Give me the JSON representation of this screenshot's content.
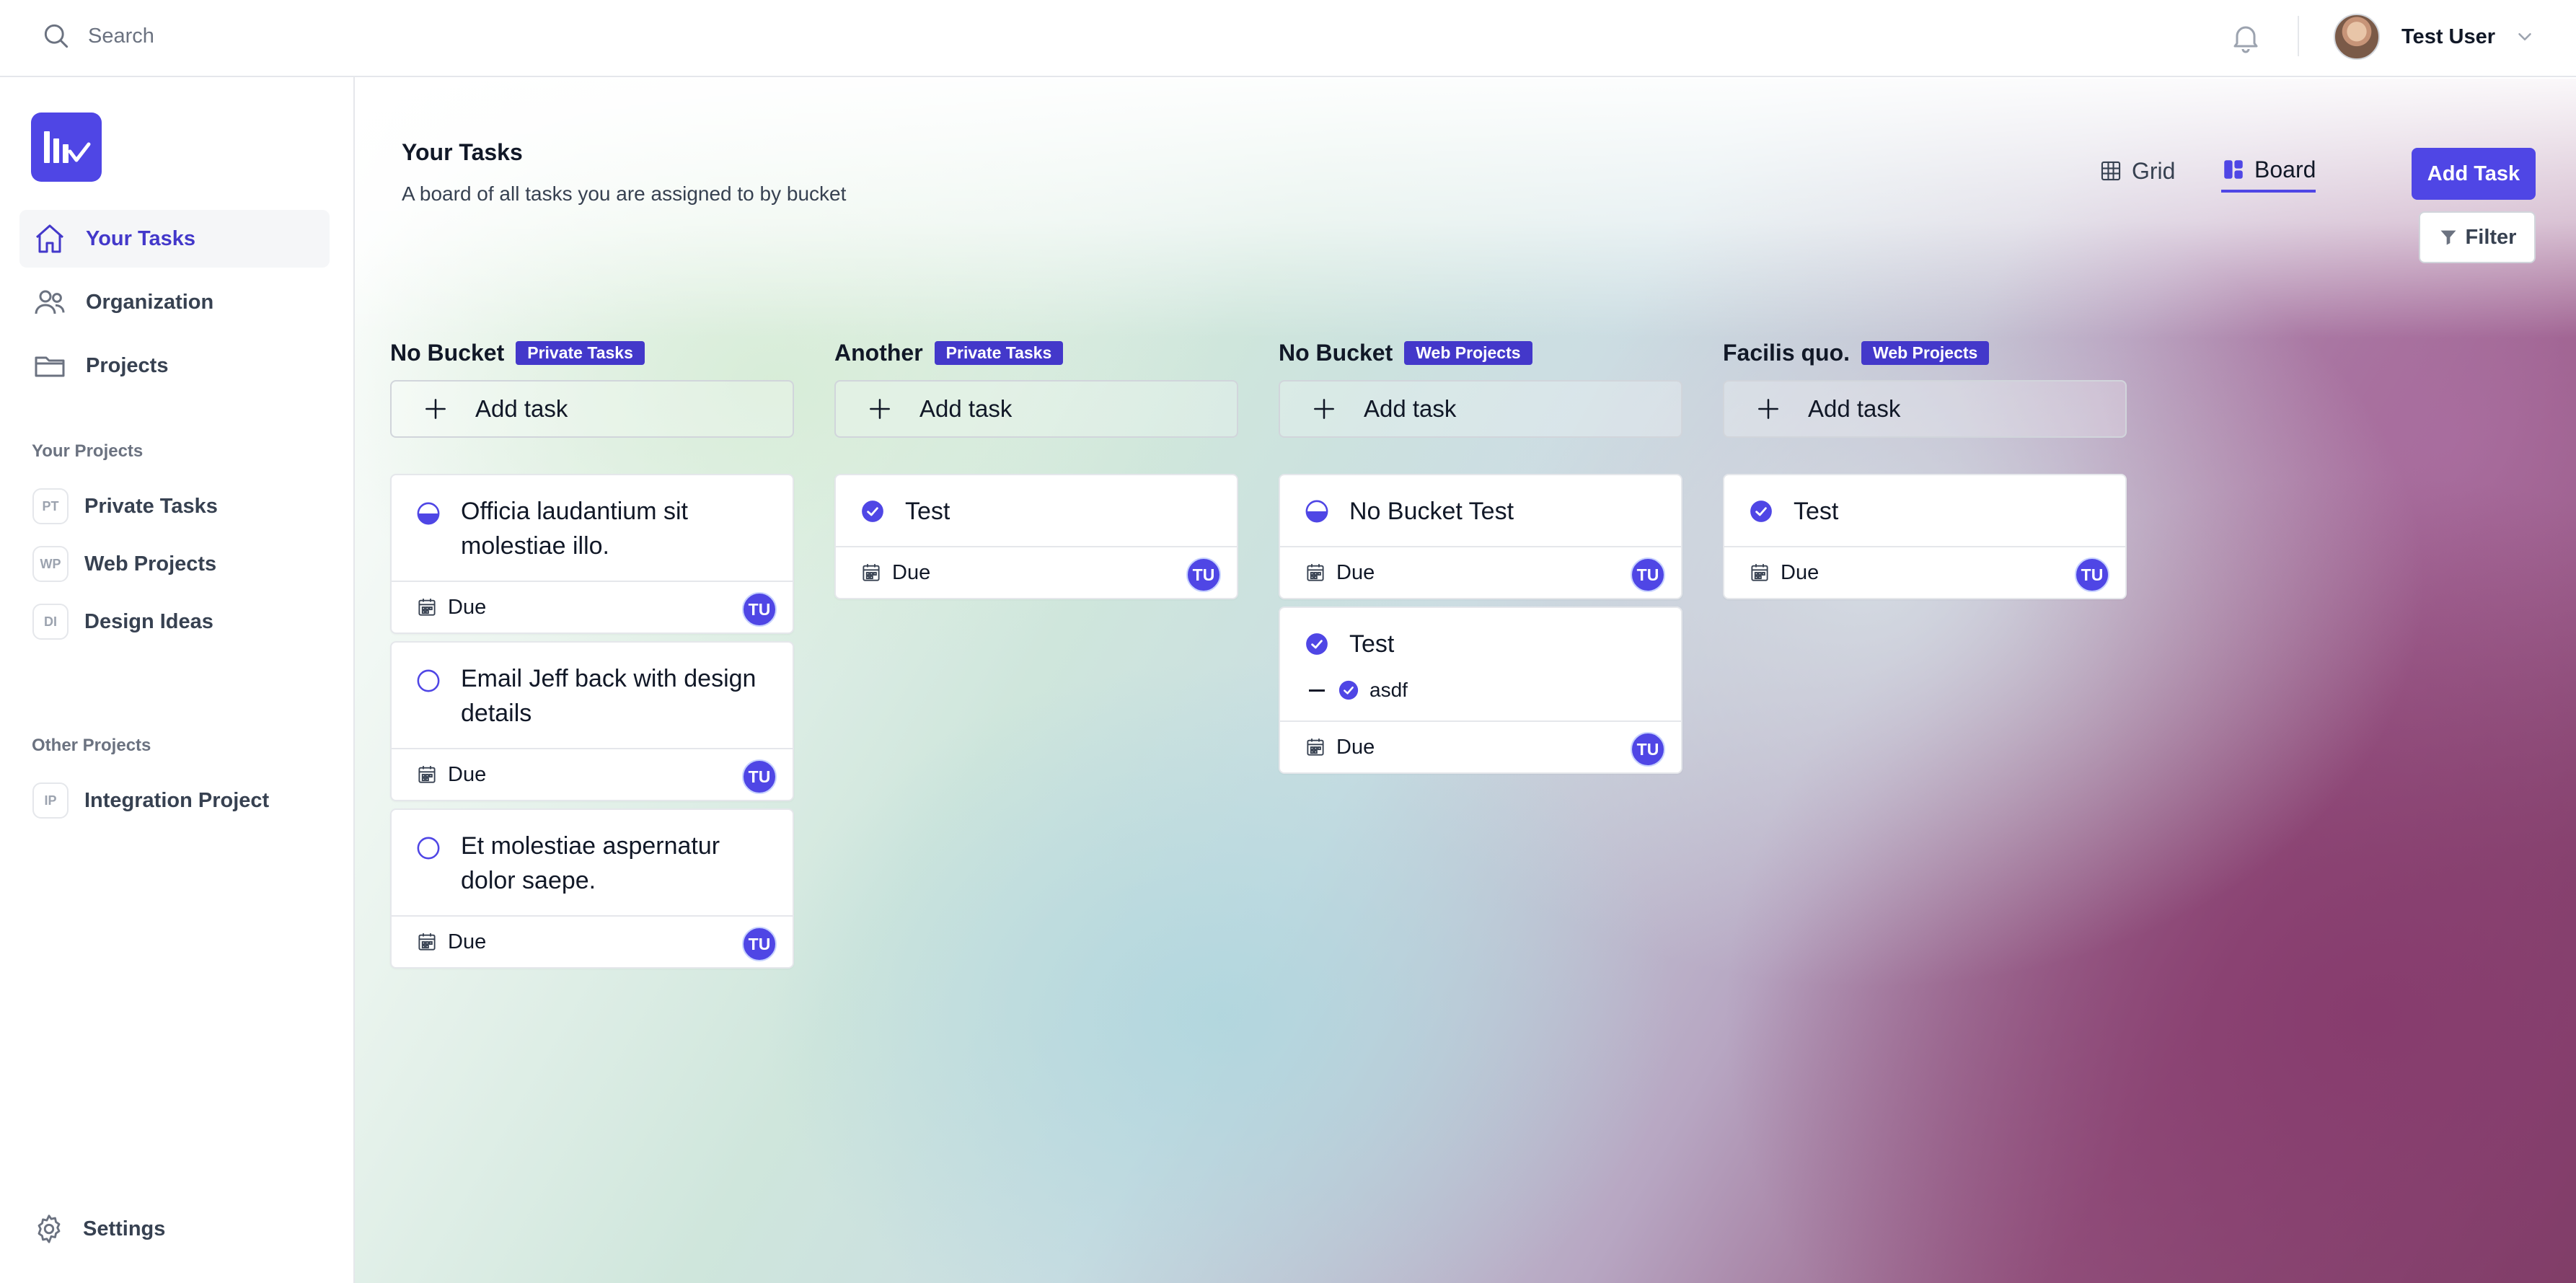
{
  "header": {
    "search_placeholder": "Search",
    "user_name": "Test User"
  },
  "sidebar": {
    "nav": [
      {
        "label": "Your Tasks",
        "icon": "home-icon"
      },
      {
        "label": "Organization",
        "icon": "users-icon"
      },
      {
        "label": "Projects",
        "icon": "folder-icon"
      }
    ],
    "your_projects_title": "Your Projects",
    "your_projects": [
      {
        "badge": "PT",
        "label": "Private Tasks"
      },
      {
        "badge": "WP",
        "label": "Web Projects"
      },
      {
        "badge": "DI",
        "label": "Design Ideas"
      }
    ],
    "other_projects_title": "Other Projects",
    "other_projects": [
      {
        "badge": "IP",
        "label": "Integration Project"
      }
    ],
    "settings_label": "Settings"
  },
  "main": {
    "title": "Your Tasks",
    "subtitle": "A board of all tasks you are assigned to by bucket",
    "views": [
      {
        "label": "Grid",
        "icon": "grid-icon"
      },
      {
        "label": "Board",
        "icon": "board-icon"
      }
    ],
    "add_task_button": "Add Task",
    "filter_button": "Filter",
    "add_task_row": "Add task",
    "due_label": "Due",
    "assignee_initials": "TU",
    "accent_color": "#4f46e5",
    "columns": [
      {
        "title": "No Bucket",
        "badge": "Private Tasks",
        "cards": [
          {
            "title": "Officia laudantium sit molestiae illo.",
            "status": "half-circle-icon"
          },
          {
            "title": "Email Jeff back with design details",
            "status": "empty-circle-icon"
          },
          {
            "title": "Et molestiae aspernatur dolor saepe.",
            "status": "empty-circle-icon"
          }
        ]
      },
      {
        "title": "Another",
        "badge": "Private Tasks",
        "cards": [
          {
            "title": "Test",
            "status": "check-circle-icon"
          }
        ]
      },
      {
        "title": "No Bucket",
        "badge": "Web Projects",
        "cards": [
          {
            "title": "No Bucket Test",
            "status": "half-circle-icon"
          },
          {
            "title": "Test",
            "status": "check-circle-icon",
            "subtask": "asdf"
          }
        ]
      },
      {
        "title": "Facilis quo.",
        "badge": "Web Projects",
        "cards": [
          {
            "title": "Test",
            "status": "check-circle-icon"
          }
        ]
      }
    ]
  }
}
